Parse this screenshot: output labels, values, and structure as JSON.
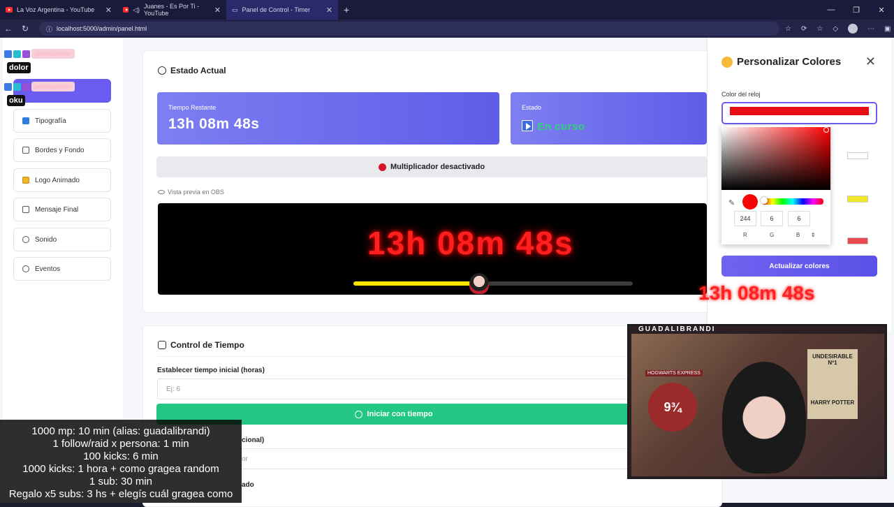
{
  "browser": {
    "tabs": [
      {
        "title": "La Voz Argentina - YouTube"
      },
      {
        "title": "Juanes - Es Por Ti - YouTube"
      },
      {
        "title": "Panel de Control - Timer"
      }
    ],
    "url": "localhost:5000/admin/panel.html"
  },
  "chat": [
    {
      "user": "peterhammer",
      "message": "dolor"
    },
    {
      "user": "peterhammer",
      "message": "oku"
    }
  ],
  "sidebar": {
    "items": [
      {
        "label": "Tipografía"
      },
      {
        "label": "Bordes y Fondo"
      },
      {
        "label": "Logo Animado"
      },
      {
        "label": "Mensaje Final"
      },
      {
        "label": "Sonido"
      },
      {
        "label": "Eventos"
      }
    ]
  },
  "estado": {
    "title": "Estado Actual",
    "tiempo_label": "Tiempo Restante",
    "tiempo_value": "13h 08m 48s",
    "estado_label": "Estado",
    "estado_value": "En curso",
    "multiplicador": "Multiplicador desactivado",
    "preview_label": "Vista previa en OBS",
    "preview_time": "13h 08m 48s",
    "progress": 0.45
  },
  "control": {
    "title": "Control de Tiempo",
    "set_label": "Establecer tiempo inicial (horas)",
    "set_placeholder": "Ej: 6",
    "start_button": "Iniciar con tiempo",
    "label2": "cional)",
    "placeholder2": "or",
    "label3": "ado"
  },
  "colors_panel": {
    "title": "Personalizar Colores",
    "field_label": "Color del reloj",
    "clock_color": "#e80d14",
    "rgb": {
      "r": "244",
      "g": "6",
      "b": "6"
    },
    "rgb_labels": [
      "R",
      "G",
      "B"
    ],
    "update_button": "Actualizar colores"
  },
  "stream": {
    "cam_title": "GUADALIBRANDI",
    "poster_line1": "UNDESIRABLE",
    "poster_line2": "Nº1",
    "poster_line3": "HARRY POTTER",
    "platform": "9¾",
    "hogwarts": "HOGWARTS EXPRESS",
    "rules": [
      "1000 mp: 10 min (alias: guadalibrandi)",
      "1 follow/raid x persona: 1 min",
      "100 kicks: 6 min",
      "1000 kicks: 1 hora + como gragea random",
      "1 sub: 30 min",
      "Regalo x5 subs: 3 hs + elegís cuál gragea como"
    ]
  }
}
